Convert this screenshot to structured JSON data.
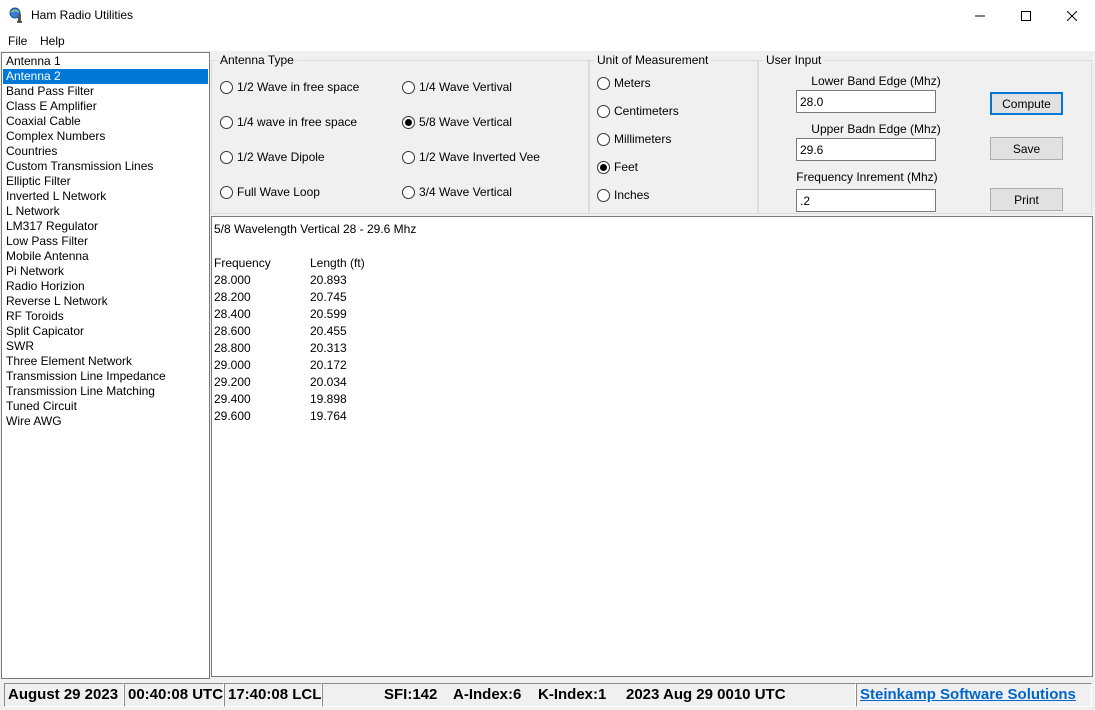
{
  "window": {
    "title": "Ham Radio Utilities"
  },
  "menu": {
    "file": "File",
    "help": "Help"
  },
  "sidebar": {
    "selected_index": 1,
    "items": [
      "Antenna 1",
      "Antenna 2",
      "Band Pass Filter",
      "Class E Amplifier",
      "Coaxial Cable",
      "Complex Numbers",
      "Countries",
      "Custom Transmission Lines",
      "Elliptic Filter",
      "Inverted L Network",
      "L Network",
      "LM317 Regulator",
      "Low Pass Filter",
      "Mobile Antenna",
      "Pi Network",
      "Radio Horizion",
      "Reverse L Network",
      "RF Toroids",
      "Split Capicator",
      "SWR",
      "Three Element Network",
      "Transmission Line Impedance",
      "Transmission Line Matching",
      "Tuned Circuit",
      "Wire AWG"
    ]
  },
  "antenna_type": {
    "legend": "Antenna Type",
    "options": [
      {
        "label": "1/2 Wave in free space",
        "checked": false
      },
      {
        "label": "1/4 wave in free space",
        "checked": false
      },
      {
        "label": "1/2 Wave Dipole",
        "checked": false
      },
      {
        "label": "Full Wave Loop",
        "checked": false
      },
      {
        "label": "1/4 Wave Vertival",
        "checked": false
      },
      {
        "label": "5/8 Wave Vertical",
        "checked": true
      },
      {
        "label": "1/2 Wave Inverted Vee",
        "checked": false
      },
      {
        "label": "3/4 Wave Vertical",
        "checked": false
      }
    ]
  },
  "units": {
    "legend": "Unit of Measurement",
    "options": [
      {
        "label": "Meters",
        "checked": false
      },
      {
        "label": "Centimeters",
        "checked": false
      },
      {
        "label": "Millimeters",
        "checked": false
      },
      {
        "label": "Feet",
        "checked": true
      },
      {
        "label": "Inches",
        "checked": false
      }
    ]
  },
  "user_input": {
    "legend": "User Input",
    "lower_label": "Lower Band Edge (Mhz)",
    "lower_value": "28.0",
    "upper_label": "Upper Badn Edge (Mhz)",
    "upper_value": "29.6",
    "increment_label": "Frequency Inrement (Mhz)",
    "increment_value": ".2"
  },
  "buttons": {
    "compute": "Compute",
    "save": "Save",
    "print": "Print"
  },
  "output": {
    "heading": "5/8 Wavelength Vertical 28 - 29.6 Mhz",
    "col_freq": "Frequency",
    "col_len": "Length (ft)",
    "rows": [
      {
        "freq": "28.000",
        "len": "20.893"
      },
      {
        "freq": "28.200",
        "len": "20.745"
      },
      {
        "freq": "28.400",
        "len": "20.599"
      },
      {
        "freq": "28.600",
        "len": "20.455"
      },
      {
        "freq": "28.800",
        "len": "20.313"
      },
      {
        "freq": "29.000",
        "len": "20.172"
      },
      {
        "freq": "29.200",
        "len": "20.034"
      },
      {
        "freq": "29.400",
        "len": "19.898"
      },
      {
        "freq": "29.600",
        "len": "19.764"
      }
    ]
  },
  "status": {
    "date": "August 29 2023",
    "utc": "00:40:08 UTC",
    "local": "17:40:08 LCL",
    "sfi": "SFI:142",
    "a_index": "A-Index:6",
    "k_index": "K-Index:1",
    "report_time": "2023 Aug 29 0010 UTC",
    "link": "Steinkamp Software Solutions"
  }
}
